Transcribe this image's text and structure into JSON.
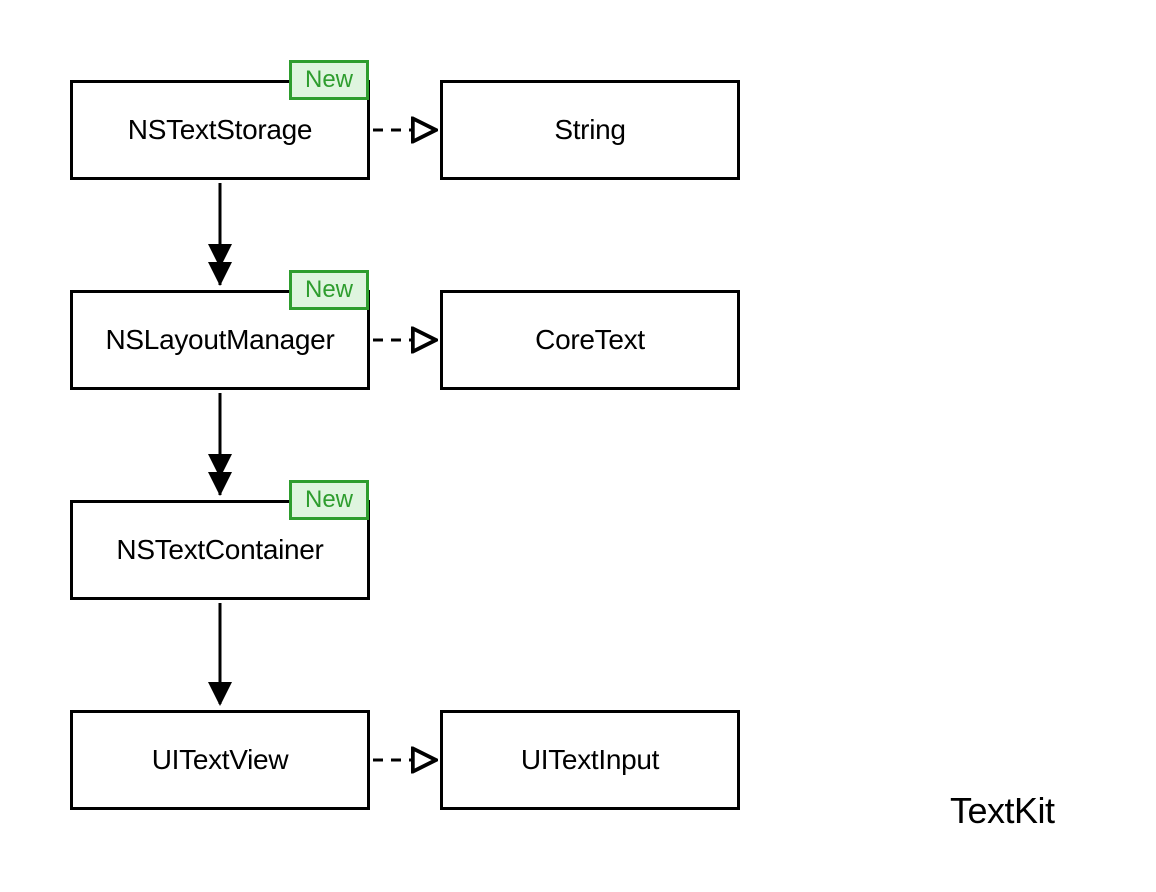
{
  "diagram": {
    "title": "TextKit",
    "boxes": {
      "nstextstorage": {
        "label": "NSTextStorage",
        "badge": "New"
      },
      "string": {
        "label": "String"
      },
      "nslayoutmanager": {
        "label": "NSLayoutManager",
        "badge": "New"
      },
      "coretext": {
        "label": "CoreText"
      },
      "nstextcontainer": {
        "label": "NSTextContainer",
        "badge": "New"
      },
      "uitextview": {
        "label": "UITextView"
      },
      "uitextinput": {
        "label": "UITextInput"
      }
    },
    "colors": {
      "badge_border": "#2e9d2e",
      "badge_fill": "#dff5df",
      "badge_text": "#2e9d2e",
      "box_border": "#000000"
    },
    "arrows": [
      {
        "from": "nstextstorage",
        "to": "string",
        "style": "dashed-open",
        "direction": "right"
      },
      {
        "from": "nstextstorage",
        "to": "nslayoutmanager",
        "style": "solid-double",
        "direction": "down"
      },
      {
        "from": "nslayoutmanager",
        "to": "coretext",
        "style": "dashed-open",
        "direction": "right"
      },
      {
        "from": "nslayoutmanager",
        "to": "nstextcontainer",
        "style": "solid-double",
        "direction": "down"
      },
      {
        "from": "nstextcontainer",
        "to": "uitextview",
        "style": "solid-single",
        "direction": "down"
      },
      {
        "from": "uitextview",
        "to": "uitextinput",
        "style": "dashed-open",
        "direction": "right"
      }
    ]
  }
}
